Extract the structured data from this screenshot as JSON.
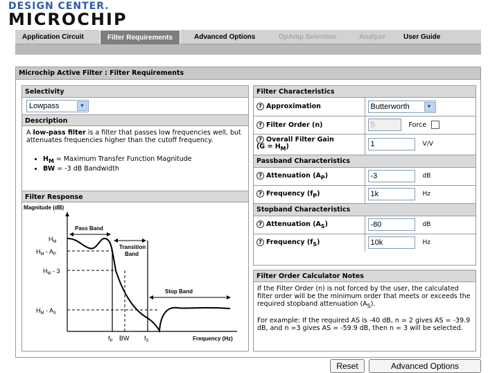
{
  "logo": {
    "top": "DESIGN CENTER.",
    "bottom": "MICROCHIP"
  },
  "tabs": [
    {
      "label": "Application Circuit"
    },
    {
      "label": "Filter Requirements"
    },
    {
      "label": "Advanced Options"
    },
    {
      "label": "OpAmp Selection"
    },
    {
      "label": "Analyze"
    },
    {
      "label": "User Guide"
    }
  ],
  "panel_title": "Microchip Active Filter : Filter Requirements",
  "selectivity": {
    "header": "Selectivity",
    "value": "Lowpass"
  },
  "description": {
    "header": "Description",
    "text_a": "A ",
    "text_bold": "low-pass filter",
    "text_b": " is a filter that passes low frequencies well, but attenuates frequencies higher than the cutoff frequency.",
    "bullet1_sym": "H",
    "bullet1_sub": "M",
    "bullet1_text": " = Maximum Transfer Function Magnitude",
    "bullet2_sym": "BW",
    "bullet2_text": " = -3 dB Bandwidth"
  },
  "response": {
    "header": "Filter Response",
    "ylabel": "Magnitude (dB)",
    "xlabel": "Frequency (Hz)",
    "pass_band": "Pass Band",
    "transition_1": "Transition",
    "transition_2": "Band",
    "stop_band": "Stop Band",
    "y_hm": "H",
    "y_hm_sub": "M",
    "y_hm_ap": "H",
    "y_hm_ap_sub": "M",
    "y_hm_ap_rest": " - A",
    "y_hm_ap_rest_sub": "P",
    "y_hm_3": "H",
    "y_hm_3_sub": "M",
    "y_hm_3_rest": " - 3",
    "y_hm_as": "H",
    "y_hm_as_sub": "M",
    "y_hm_as_rest": " - A",
    "y_hm_as_rest_sub": "S",
    "x_fp": "f",
    "x_fp_sub": "P",
    "x_bw": "BW",
    "x_fs": "f",
    "x_fs_sub": "S"
  },
  "characteristics": {
    "header": "Filter Characteristics",
    "approximation_label": "Approximation",
    "approximation_value": "Butterworth",
    "order_label": "Filter Order (n)",
    "order_value": "5",
    "force_label": "Force",
    "gain_label_1": "Overall Filter Gain",
    "gain_label_2": "(G = H",
    "gain_label_sub": "M",
    "gain_label_3": ")",
    "gain_value": "1",
    "gain_unit": "V/V"
  },
  "passband": {
    "header": "Passband Characteristics",
    "atten_label": "Attenuation (A",
    "atten_sub": "P",
    "atten_close": ")",
    "atten_value": "-3",
    "atten_unit": "dB",
    "freq_label": "Frequency (f",
    "freq_sub": "P",
    "freq_close": ")",
    "freq_value": "1k",
    "freq_unit": "Hz"
  },
  "stopband": {
    "header": "Stopband Characteristics",
    "atten_label": "Attenuation (A",
    "atten_sub": "S",
    "atten_close": ")",
    "atten_value": "-80",
    "atten_unit": "dB",
    "freq_label": "Frequency (f",
    "freq_sub": "S",
    "freq_close": ")",
    "freq_value": "10k",
    "freq_unit": "Hz"
  },
  "notes": {
    "header": "Filter Order Calculator Notes",
    "p1_a": "If the Filter Order (n) is not forced by the user, the calculated filter order will be the minimum order that meets or exceeds the required stopband attenuation (A",
    "p1_sub": "S",
    "p1_b": ").",
    "p2": "For example: If the required AS is -40 dB, n = 2 gives AS = -39.9 dB, and n =3 gives AS = -59.9 dB, then n = 3 will be selected."
  },
  "buttons": {
    "reset": "Reset",
    "advanced": "Advanced Options"
  }
}
